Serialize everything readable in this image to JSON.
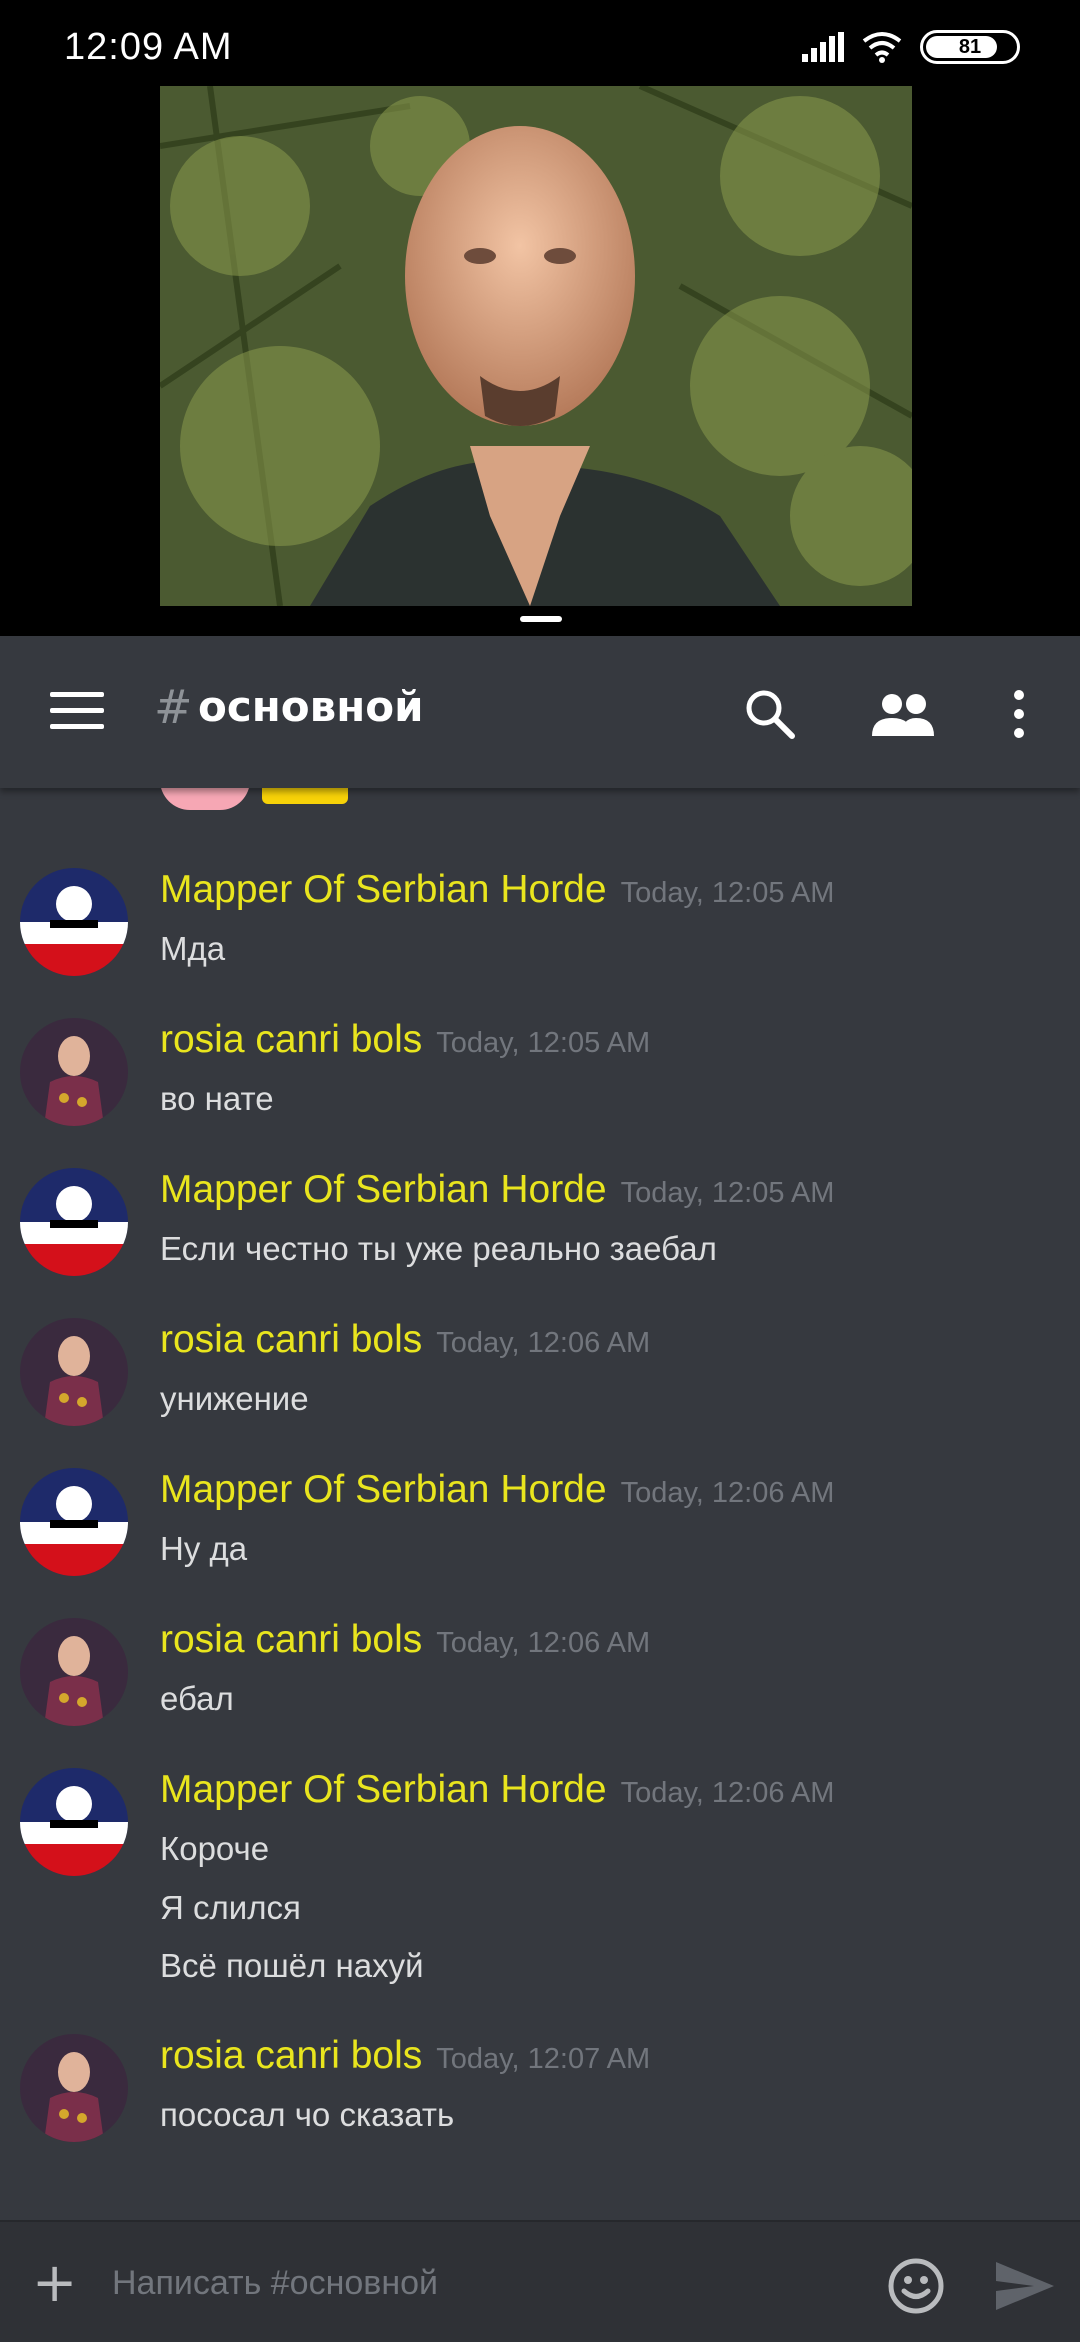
{
  "status_bar": {
    "time": "12:09  AM",
    "battery": "81"
  },
  "header": {
    "hash": "#",
    "channel_name": "основной"
  },
  "messages": [
    {
      "user": "Mapper Of Serbian Horde",
      "time": "Today, 12:05 AM",
      "lines": [
        "Мда"
      ],
      "avatar": "serbia-ball"
    },
    {
      "user": "rosia canri bols",
      "time": "Today, 12:05 AM",
      "lines": [
        "во нате"
      ],
      "avatar": "person-photo"
    },
    {
      "user": "Mapper Of Serbian Horde",
      "time": "Today, 12:05 AM",
      "lines": [
        "Если честно ты уже реально заебал"
      ],
      "avatar": "serbia-ball"
    },
    {
      "user": "rosia canri bols",
      "time": "Today, 12:06 AM",
      "lines": [
        "унижение"
      ],
      "avatar": "person-photo"
    },
    {
      "user": "Mapper Of Serbian Horde",
      "time": "Today, 12:06 AM",
      "lines": [
        "Ну да"
      ],
      "avatar": "serbia-ball"
    },
    {
      "user": "rosia canri bols",
      "time": "Today, 12:06 AM",
      "lines": [
        "ебал"
      ],
      "avatar": "person-photo"
    },
    {
      "user": "Mapper Of Serbian Horde",
      "time": "Today, 12:06 AM",
      "lines": [
        "Короче",
        "Я слился",
        "Всё пошёл нахуй"
      ],
      "avatar": "serbia-ball"
    },
    {
      "user": "rosia canri bols",
      "time": "Today, 12:07 AM",
      "lines": [
        "пососал чо сказать"
      ],
      "avatar": "person-photo"
    }
  ],
  "input": {
    "placeholder": "Написать #основной"
  },
  "colors": {
    "username": "#e9e51e",
    "background": "#36393f",
    "input_bar": "#2f3136"
  }
}
